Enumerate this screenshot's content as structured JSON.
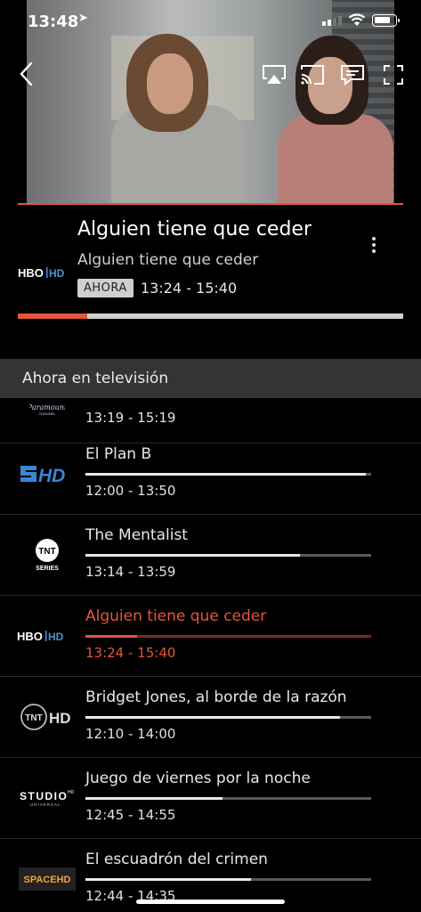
{
  "status_bar": {
    "time": "13:48",
    "location_glyph": "➤"
  },
  "player": {
    "colors": {
      "accent": "#e5553a"
    }
  },
  "now_playing": {
    "channel_logo": "HBO|HD",
    "title": "Alguien tiene que ceder",
    "subtitle": "Alguien tiene que ceder",
    "badge": "AHORA",
    "time": "13:24 - 15:40",
    "progress": 0.18
  },
  "section": {
    "title": "Ahora en televisión"
  },
  "channels": [
    {
      "logo": "Paramount Channel",
      "title": "",
      "time": "13:19 - 15:19",
      "progress": null
    },
    {
      "logo": "SHD",
      "title": "El Plan B",
      "time": "12:00 - 13:50",
      "progress": 0.98
    },
    {
      "logo": "TNT SERIES",
      "title": "The Mentalist",
      "time": "13:14 - 13:59",
      "progress": 0.75
    },
    {
      "logo": "HBO|HD",
      "title": "Alguien tiene que ceder",
      "time": "13:24 - 15:40",
      "progress": 0.18
    },
    {
      "logo": "TNT HD",
      "title": "Bridget Jones, al borde de la razón",
      "time": "12:10 - 14:00",
      "progress": 0.89
    },
    {
      "logo": "STUDIO HD UNIVERSAL",
      "title": "Juego de viernes por la noche",
      "time": "12:45 - 14:55",
      "progress": 0.48
    },
    {
      "logo": "SPACEHD",
      "title": "El escuadrón del crimen",
      "time": "12:44 - 14:35",
      "progress": 0.58
    }
  ]
}
